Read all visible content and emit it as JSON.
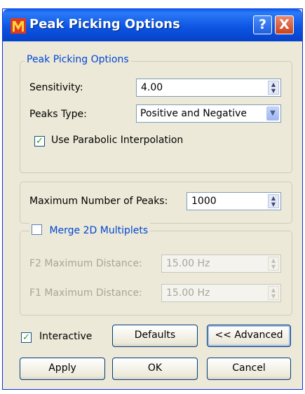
{
  "window": {
    "title": "Peak Picking Options",
    "help_label": "?",
    "close_label": "X"
  },
  "peak_group": {
    "legend": "Peak Picking Options",
    "sensitivity_label": "Sensitivity:",
    "sensitivity_value": "4.00",
    "peaks_type_label": "Peaks Type:",
    "peaks_type_value": "Positive and Negative",
    "parabolic_label": "Use Parabolic Interpolation",
    "parabolic_checked": true
  },
  "max_group": {
    "label": "Maximum Number of Peaks:",
    "value": "1000"
  },
  "merge_group": {
    "legend": "Merge 2D Multiplets",
    "checked": false,
    "f2_label": "F2 Maximum Distance:",
    "f2_value": "15.00 Hz",
    "f1_label": "F1 Maximum Distance:",
    "f1_value": "15.00 Hz"
  },
  "footer": {
    "interactive_label": "Interactive",
    "interactive_checked": true,
    "defaults_label": "Defaults",
    "advanced_label": "<< Advanced",
    "apply_label": "Apply",
    "ok_label": "OK",
    "cancel_label": "Cancel"
  },
  "icons": {
    "app": "app-logo-icon",
    "help": "help-icon",
    "close": "close-icon",
    "check": "check-icon",
    "spin": "spin-arrows-icon",
    "dropdown": "chevron-down-icon"
  }
}
